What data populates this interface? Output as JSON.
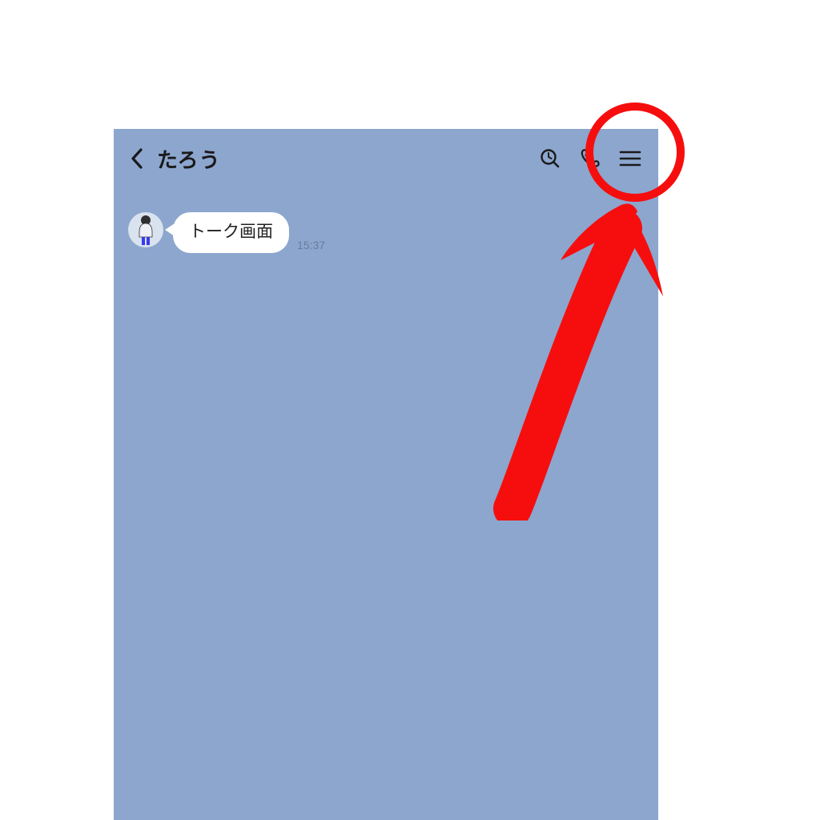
{
  "header": {
    "title": "たろう",
    "icons": {
      "back": "chevron-left-icon",
      "search": "search-icon",
      "call": "phone-icon",
      "menu": "hamburger-menu-icon"
    }
  },
  "messages": [
    {
      "sender": "other",
      "text": "トーク画面",
      "time": "15:37"
    }
  ],
  "annotation": {
    "color": "#f60e0e",
    "target": "hamburger-menu-icon"
  }
}
